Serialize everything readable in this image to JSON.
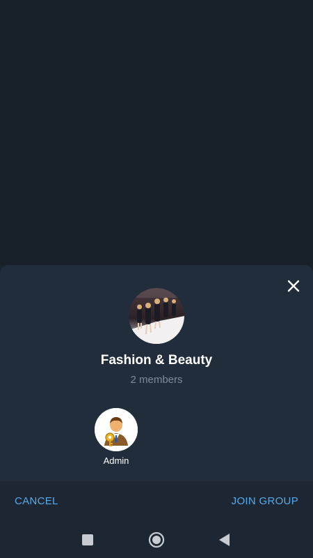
{
  "sheet": {
    "group_title": "Fashion & Beauty",
    "members_count": "2 members",
    "members": [
      {
        "name": "Admin"
      }
    ]
  },
  "actions": {
    "cancel_label": "CANCEL",
    "join_label": "JOIN GROUP"
  },
  "icons": {
    "close": "close-icon",
    "nav_recents": "square-icon",
    "nav_home": "circle-icon",
    "nav_back": "triangle-back-icon"
  },
  "colors": {
    "accent": "#5aa9e6",
    "sheet_bg": "#212d3b",
    "backdrop_bg": "#18202a",
    "muted_text": "#7d8b99"
  }
}
